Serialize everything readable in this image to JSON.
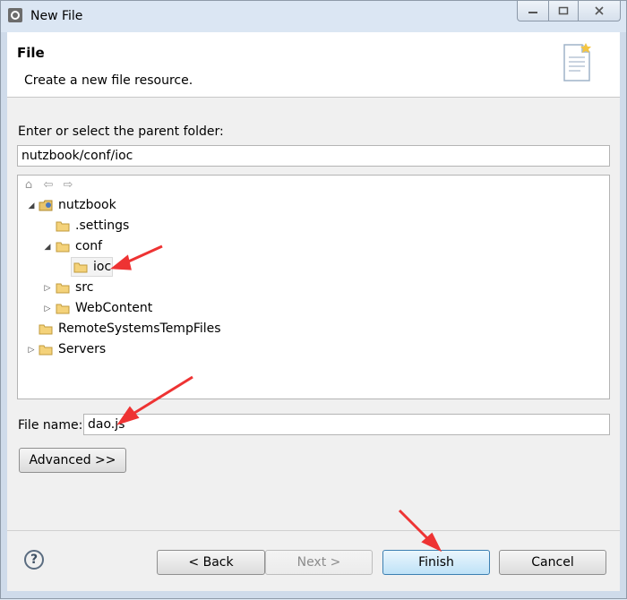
{
  "window": {
    "title": "New File"
  },
  "banner": {
    "title": "File",
    "description": "Create a new file resource."
  },
  "parent_folder": {
    "label": "Enter or select the parent folder:",
    "value": "nutzbook/conf/ioc"
  },
  "tree": {
    "items": [
      {
        "label": "nutzbook",
        "level": 0,
        "expanded": true,
        "icon": "project-icon"
      },
      {
        "label": ".settings",
        "level": 1,
        "icon": "folder-icon"
      },
      {
        "label": "conf",
        "level": 1,
        "expanded": true,
        "icon": "folder-icon"
      },
      {
        "label": "ioc",
        "level": 2,
        "selected": true,
        "icon": "folder-icon"
      },
      {
        "label": "src",
        "level": 1,
        "expanded": false,
        "icon": "folder-icon"
      },
      {
        "label": "WebContent",
        "level": 1,
        "expanded": false,
        "icon": "folder-icon"
      },
      {
        "label": "RemoteSystemsTempFiles",
        "level": 0,
        "icon": "project-icon"
      },
      {
        "label": "Servers",
        "level": 0,
        "expanded": false,
        "icon": "project-icon"
      }
    ]
  },
  "file_name": {
    "label": "File name:",
    "value": "dao.js"
  },
  "buttons": {
    "advanced": "Advanced >>",
    "back": "< Back",
    "next": "Next >",
    "finish": "Finish",
    "cancel": "Cancel",
    "help": "?"
  },
  "colors": {
    "accent_arrow": "#ee3333",
    "primary_button": "#bfe2f7"
  }
}
